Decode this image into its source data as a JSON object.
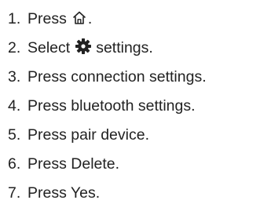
{
  "steps": [
    {
      "number": "1.",
      "before": "Press",
      "icon": "home-icon",
      "after": "."
    },
    {
      "number": "2.",
      "before": "Select",
      "icon": "gear-icon",
      "after": "settings."
    },
    {
      "number": "3.",
      "text": "Press connection settings."
    },
    {
      "number": "4.",
      "text": "Press bluetooth settings."
    },
    {
      "number": "5.",
      "text": "Press pair device."
    },
    {
      "number": "6.",
      "text": "Press Delete."
    },
    {
      "number": "7.",
      "text": "Press Yes."
    }
  ],
  "colors": {
    "text": "#222222",
    "background": "#ffffff"
  }
}
